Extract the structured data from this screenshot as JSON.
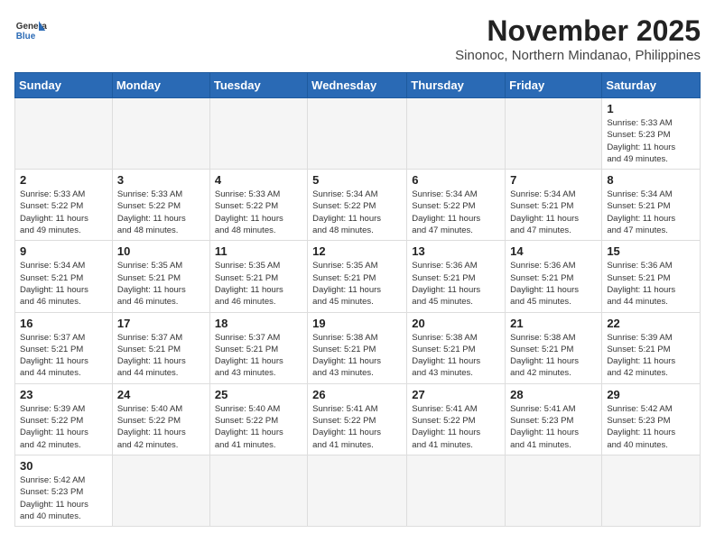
{
  "header": {
    "logo_general": "General",
    "logo_blue": "Blue",
    "month_title": "November 2025",
    "location": "Sinonoc, Northern Mindanao, Philippines"
  },
  "days_of_week": [
    "Sunday",
    "Monday",
    "Tuesday",
    "Wednesday",
    "Thursday",
    "Friday",
    "Saturday"
  ],
  "weeks": [
    [
      {
        "day": "",
        "info": ""
      },
      {
        "day": "",
        "info": ""
      },
      {
        "day": "",
        "info": ""
      },
      {
        "day": "",
        "info": ""
      },
      {
        "day": "",
        "info": ""
      },
      {
        "day": "",
        "info": ""
      },
      {
        "day": "1",
        "info": "Sunrise: 5:33 AM\nSunset: 5:23 PM\nDaylight: 11 hours\nand 49 minutes."
      }
    ],
    [
      {
        "day": "2",
        "info": "Sunrise: 5:33 AM\nSunset: 5:22 PM\nDaylight: 11 hours\nand 49 minutes."
      },
      {
        "day": "3",
        "info": "Sunrise: 5:33 AM\nSunset: 5:22 PM\nDaylight: 11 hours\nand 48 minutes."
      },
      {
        "day": "4",
        "info": "Sunrise: 5:33 AM\nSunset: 5:22 PM\nDaylight: 11 hours\nand 48 minutes."
      },
      {
        "day": "5",
        "info": "Sunrise: 5:34 AM\nSunset: 5:22 PM\nDaylight: 11 hours\nand 48 minutes."
      },
      {
        "day": "6",
        "info": "Sunrise: 5:34 AM\nSunset: 5:22 PM\nDaylight: 11 hours\nand 47 minutes."
      },
      {
        "day": "7",
        "info": "Sunrise: 5:34 AM\nSunset: 5:21 PM\nDaylight: 11 hours\nand 47 minutes."
      },
      {
        "day": "8",
        "info": "Sunrise: 5:34 AM\nSunset: 5:21 PM\nDaylight: 11 hours\nand 47 minutes."
      }
    ],
    [
      {
        "day": "9",
        "info": "Sunrise: 5:34 AM\nSunset: 5:21 PM\nDaylight: 11 hours\nand 46 minutes."
      },
      {
        "day": "10",
        "info": "Sunrise: 5:35 AM\nSunset: 5:21 PM\nDaylight: 11 hours\nand 46 minutes."
      },
      {
        "day": "11",
        "info": "Sunrise: 5:35 AM\nSunset: 5:21 PM\nDaylight: 11 hours\nand 46 minutes."
      },
      {
        "day": "12",
        "info": "Sunrise: 5:35 AM\nSunset: 5:21 PM\nDaylight: 11 hours\nand 45 minutes."
      },
      {
        "day": "13",
        "info": "Sunrise: 5:36 AM\nSunset: 5:21 PM\nDaylight: 11 hours\nand 45 minutes."
      },
      {
        "day": "14",
        "info": "Sunrise: 5:36 AM\nSunset: 5:21 PM\nDaylight: 11 hours\nand 45 minutes."
      },
      {
        "day": "15",
        "info": "Sunrise: 5:36 AM\nSunset: 5:21 PM\nDaylight: 11 hours\nand 44 minutes."
      }
    ],
    [
      {
        "day": "16",
        "info": "Sunrise: 5:37 AM\nSunset: 5:21 PM\nDaylight: 11 hours\nand 44 minutes."
      },
      {
        "day": "17",
        "info": "Sunrise: 5:37 AM\nSunset: 5:21 PM\nDaylight: 11 hours\nand 44 minutes."
      },
      {
        "day": "18",
        "info": "Sunrise: 5:37 AM\nSunset: 5:21 PM\nDaylight: 11 hours\nand 43 minutes."
      },
      {
        "day": "19",
        "info": "Sunrise: 5:38 AM\nSunset: 5:21 PM\nDaylight: 11 hours\nand 43 minutes."
      },
      {
        "day": "20",
        "info": "Sunrise: 5:38 AM\nSunset: 5:21 PM\nDaylight: 11 hours\nand 43 minutes."
      },
      {
        "day": "21",
        "info": "Sunrise: 5:38 AM\nSunset: 5:21 PM\nDaylight: 11 hours\nand 42 minutes."
      },
      {
        "day": "22",
        "info": "Sunrise: 5:39 AM\nSunset: 5:21 PM\nDaylight: 11 hours\nand 42 minutes."
      }
    ],
    [
      {
        "day": "23",
        "info": "Sunrise: 5:39 AM\nSunset: 5:22 PM\nDaylight: 11 hours\nand 42 minutes."
      },
      {
        "day": "24",
        "info": "Sunrise: 5:40 AM\nSunset: 5:22 PM\nDaylight: 11 hours\nand 42 minutes."
      },
      {
        "day": "25",
        "info": "Sunrise: 5:40 AM\nSunset: 5:22 PM\nDaylight: 11 hours\nand 41 minutes."
      },
      {
        "day": "26",
        "info": "Sunrise: 5:41 AM\nSunset: 5:22 PM\nDaylight: 11 hours\nand 41 minutes."
      },
      {
        "day": "27",
        "info": "Sunrise: 5:41 AM\nSunset: 5:22 PM\nDaylight: 11 hours\nand 41 minutes."
      },
      {
        "day": "28",
        "info": "Sunrise: 5:41 AM\nSunset: 5:23 PM\nDaylight: 11 hours\nand 41 minutes."
      },
      {
        "day": "29",
        "info": "Sunrise: 5:42 AM\nSunset: 5:23 PM\nDaylight: 11 hours\nand 40 minutes."
      }
    ],
    [
      {
        "day": "30",
        "info": "Sunrise: 5:42 AM\nSunset: 5:23 PM\nDaylight: 11 hours\nand 40 minutes."
      },
      {
        "day": "",
        "info": ""
      },
      {
        "day": "",
        "info": ""
      },
      {
        "day": "",
        "info": ""
      },
      {
        "day": "",
        "info": ""
      },
      {
        "day": "",
        "info": ""
      },
      {
        "day": "",
        "info": ""
      }
    ]
  ]
}
